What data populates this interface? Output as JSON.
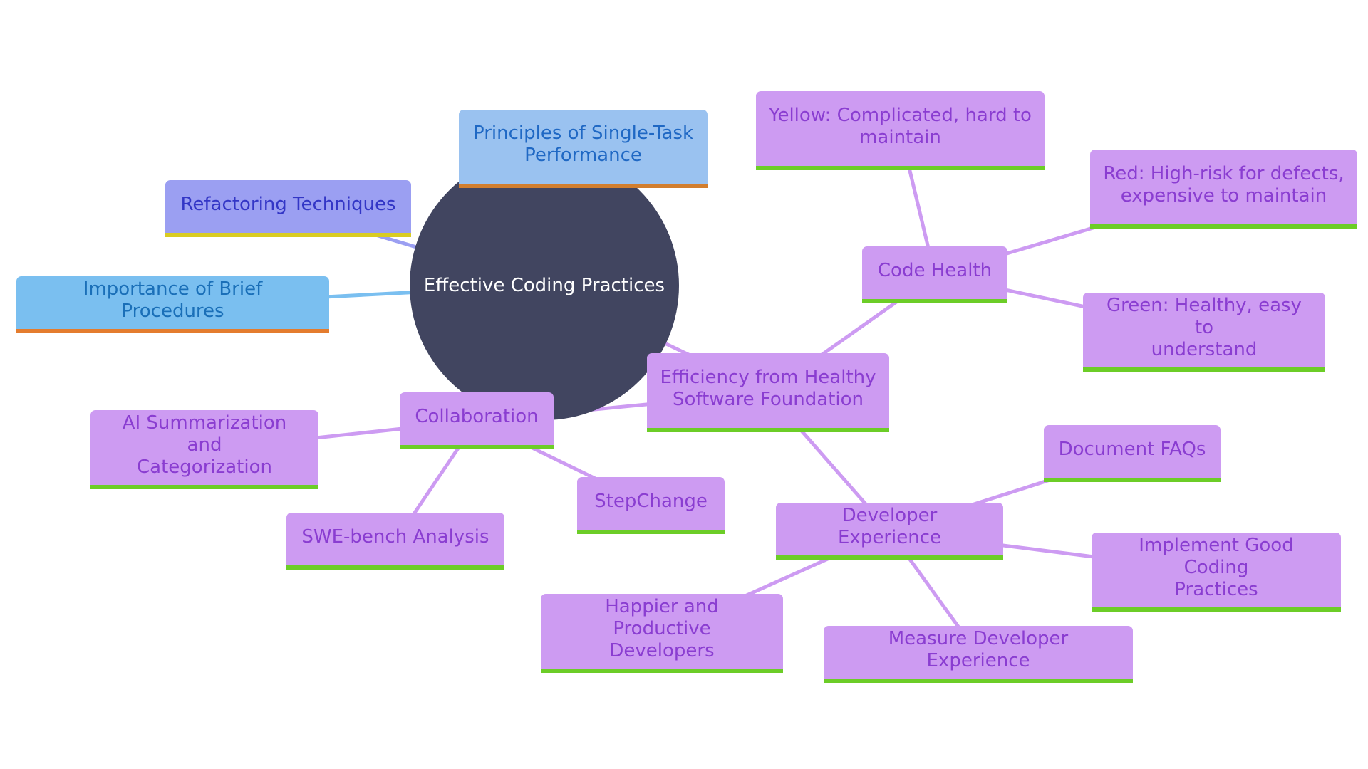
{
  "diagram": {
    "type": "mindmap",
    "root": {
      "id": "root",
      "label": "Effective Coding Practices",
      "color": "#414560"
    },
    "nodes": [
      {
        "id": "principles",
        "label": "Principles of Single-Task Performance",
        "parent": "root",
        "style": "lightblue"
      },
      {
        "id": "refactoring",
        "label": "Refactoring Techniques",
        "parent": "root",
        "style": "periwinkle"
      },
      {
        "id": "importance",
        "label": "Importance of Brief Procedures",
        "parent": "root",
        "style": "skyblue"
      },
      {
        "id": "efficiency",
        "label": "Efficiency from Healthy Software Foundation",
        "parent": "root",
        "style": "purple"
      },
      {
        "id": "codehealth",
        "label": "Code Health",
        "parent": "efficiency",
        "style": "purple"
      },
      {
        "id": "yellow",
        "label": "Yellow: Complicated, hard to maintain",
        "parent": "codehealth",
        "style": "purple"
      },
      {
        "id": "red",
        "label": "Red: High-risk for defects, expensive to maintain",
        "parent": "codehealth",
        "style": "purple"
      },
      {
        "id": "green",
        "label": "Green: Healthy, easy to understand",
        "parent": "codehealth",
        "style": "purple"
      },
      {
        "id": "collaboration",
        "label": "Collaboration",
        "parent": "efficiency",
        "style": "purple"
      },
      {
        "id": "aisumm",
        "label": "AI Summarization and Categorization",
        "parent": "collaboration",
        "style": "purple"
      },
      {
        "id": "swebench",
        "label": "SWE-bench Analysis",
        "parent": "collaboration",
        "style": "purple"
      },
      {
        "id": "stepchange",
        "label": "StepChange",
        "parent": "collaboration",
        "style": "purple"
      },
      {
        "id": "devexp",
        "label": "Developer Experience",
        "parent": "efficiency",
        "style": "purple"
      },
      {
        "id": "docfaqs",
        "label": "Document FAQs",
        "parent": "devexp",
        "style": "purple"
      },
      {
        "id": "implement",
        "label": "Implement Good Coding Practices",
        "parent": "devexp",
        "style": "purple"
      },
      {
        "id": "happier",
        "label": "Happier and Productive Developers",
        "parent": "devexp",
        "style": "purple"
      },
      {
        "id": "measure",
        "label": "Measure Developer Experience",
        "parent": "devexp",
        "style": "purple"
      }
    ],
    "lines": [
      {
        "label": [
          "Principles of Single-Task",
          "Performance"
        ]
      }
    ],
    "text": {
      "root": "Effective Coding Practices",
      "principles": [
        "Principles of Single-Task",
        "Performance"
      ],
      "refactoring": [
        "Refactoring Techniques"
      ],
      "importance": [
        "Importance of Brief Procedures"
      ],
      "efficiency": [
        "Efficiency from Healthy",
        "Software Foundation"
      ],
      "codehealth": [
        "Code Health"
      ],
      "yellow": [
        "Yellow: Complicated, hard to",
        "maintain"
      ],
      "red": [
        "Red: High-risk for defects,",
        "expensive to maintain"
      ],
      "green": [
        "Green: Healthy, easy to",
        "understand"
      ],
      "collaboration": [
        "Collaboration"
      ],
      "aisumm": [
        "AI Summarization and",
        "Categorization"
      ],
      "swebench": [
        "SWE-bench Analysis"
      ],
      "stepchange": [
        "StepChange"
      ],
      "devexp": [
        "Developer Experience"
      ],
      "docfaqs": [
        "Document FAQs"
      ],
      "implement": [
        "Implement Good Coding",
        "Practices"
      ],
      "happier": [
        "Happier and Productive",
        "Developers"
      ],
      "measure": [
        "Measure Developer Experience"
      ]
    },
    "colors": {
      "purple_fill": "#cd9bf2",
      "purple_text": "#8a3dd1",
      "green_accent": "#6ccd27",
      "lightblue_fill": "#9ac2f0",
      "skyblue_fill": "#7abff0",
      "periwinkle_fill": "#9b9ff2",
      "orange_accent": "#e47c2e",
      "yellow_accent": "#d9cc22",
      "edge_purple": "#cd9bf2",
      "edge_blue": "#7abff0",
      "edge_periwinkle": "#9b9ff2"
    }
  }
}
